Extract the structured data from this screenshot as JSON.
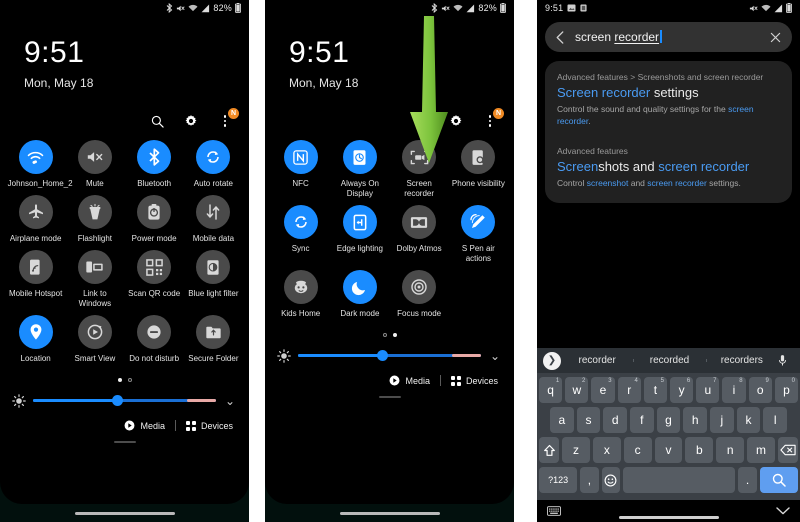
{
  "panel1": {
    "status": {
      "bluetooth": "bluetooth-icon",
      "mute": "mute-icon",
      "wifi": "wifi-icon",
      "signal": "signal-icon",
      "battery_text": "82%",
      "battery": "battery-icon"
    },
    "clock": {
      "time": "9:51",
      "date": "Mon, May 18"
    },
    "header_icons": {
      "search": "search-icon",
      "settings": "gear-icon",
      "more": "kebab-menu-icon",
      "badge": "N"
    },
    "tiles": [
      {
        "label": "Johnson_Home_2",
        "icon": "wifi",
        "on": true
      },
      {
        "label": "Mute",
        "icon": "mute",
        "on": false
      },
      {
        "label": "Bluetooth",
        "icon": "bluetooth",
        "on": true
      },
      {
        "label": "Auto rotate",
        "icon": "autorotate",
        "on": true
      },
      {
        "label": "Airplane mode",
        "icon": "airplane",
        "on": false
      },
      {
        "label": "Flashlight",
        "icon": "flashlight",
        "on": false
      },
      {
        "label": "Power mode",
        "icon": "powermode",
        "on": false
      },
      {
        "label": "Mobile data",
        "icon": "mobiledata",
        "on": false
      },
      {
        "label": "Mobile Hotspot",
        "icon": "hotspot",
        "on": false
      },
      {
        "label": "Link to Windows",
        "icon": "linkwindows",
        "on": false
      },
      {
        "label": "Scan QR code",
        "icon": "qr",
        "on": false
      },
      {
        "label": "Blue light filter",
        "icon": "bluelight",
        "on": false
      },
      {
        "label": "Location",
        "icon": "location",
        "on": true
      },
      {
        "label": "Smart View",
        "icon": "smartview",
        "on": false
      },
      {
        "label": "Do not disturb",
        "icon": "dnd",
        "on": false
      },
      {
        "label": "Secure Folder",
        "icon": "securefolder",
        "on": false
      }
    ],
    "page_dots": {
      "count": 2,
      "active_index": 0
    },
    "brightness": {
      "value_percent": 46,
      "icon": "brightness-icon",
      "expand": "chevron-down-icon"
    },
    "footer": {
      "media_label": "Media",
      "devices_label": "Devices"
    }
  },
  "panel2": {
    "status": {
      "battery_text": "82%"
    },
    "clock": {
      "time": "9:51",
      "date": "Mon, May 18"
    },
    "header_icons": {
      "search": "search-icon",
      "settings": "gear-icon",
      "more": "kebab-menu-icon",
      "badge": "N"
    },
    "annotation": {
      "type": "green-down-arrow",
      "color_light": "#9ad64a",
      "color_dark": "#5fa323"
    },
    "tiles": [
      {
        "label": "NFC",
        "icon": "nfc",
        "on": true
      },
      {
        "label": "Always On Display",
        "icon": "aod",
        "on": true
      },
      {
        "label": "Screen recorder",
        "icon": "screenrecorder",
        "on": false
      },
      {
        "label": "Phone visibility",
        "icon": "phonevisibility",
        "on": false
      },
      {
        "label": "Sync",
        "icon": "sync",
        "on": true
      },
      {
        "label": "Edge lighting",
        "icon": "edgelighting",
        "on": true
      },
      {
        "label": "Dolby Atmos",
        "icon": "dolby",
        "on": false
      },
      {
        "label": "S Pen air actions",
        "icon": "spen",
        "on": true
      },
      {
        "label": "Kids Home",
        "icon": "kids",
        "on": false
      },
      {
        "label": "Dark mode",
        "icon": "darkmode",
        "on": true
      },
      {
        "label": "Focus mode",
        "icon": "focusmode",
        "on": false
      },
      {
        "label": "",
        "icon": "none",
        "on": false
      }
    ],
    "page_dots": {
      "count": 2,
      "active_index": 1
    },
    "brightness": {
      "value_percent": 46
    },
    "footer": {
      "media_label": "Media",
      "devices_label": "Devices"
    }
  },
  "panel3": {
    "status": {
      "time": "9:51",
      "left_icons": [
        "screenshot-icon",
        "app-icon"
      ],
      "right_icons": [
        "mute-icon",
        "wifi-icon",
        "signal-icon",
        "battery-icon"
      ]
    },
    "search": {
      "back": "back-arrow-icon",
      "query_plain": "screen ",
      "query_composing": "recorder",
      "clear": "close-icon"
    },
    "results": [
      {
        "breadcrumb": "Advanced features > Screenshots and screen recorder",
        "title_parts": [
          {
            "t": "Screen recorder",
            "hl": true
          },
          {
            "t": " settings",
            "hl": false
          }
        ],
        "desc_parts": [
          {
            "t": "Control the sound and quality settings for the ",
            "hl": false
          },
          {
            "t": "screen recorder",
            "hl": true
          },
          {
            "t": ".",
            "hl": false
          }
        ]
      },
      {
        "breadcrumb": "Advanced features",
        "title_parts": [
          {
            "t": "Screen",
            "hl": true
          },
          {
            "t": "shots and ",
            "hl": false
          },
          {
            "t": "screen recorder",
            "hl": true
          }
        ],
        "desc_parts": [
          {
            "t": "Control ",
            "hl": false
          },
          {
            "t": "screenshot",
            "hl": true
          },
          {
            "t": " and ",
            "hl": false
          },
          {
            "t": "screen recorder",
            "hl": true
          },
          {
            "t": " settings.",
            "hl": false
          }
        ]
      }
    ],
    "keyboard": {
      "suggestions": [
        "recorder",
        "recorded",
        "recorders"
      ],
      "expand_icon": "chevron-right-icon",
      "mic_icon": "microphone-icon",
      "row1": [
        {
          "k": "q",
          "n": "1"
        },
        {
          "k": "w",
          "n": "2"
        },
        {
          "k": "e",
          "n": "3"
        },
        {
          "k": "r",
          "n": "4"
        },
        {
          "k": "t",
          "n": "5"
        },
        {
          "k": "y",
          "n": "6"
        },
        {
          "k": "u",
          "n": "7"
        },
        {
          "k": "i",
          "n": "8"
        },
        {
          "k": "o",
          "n": "9"
        },
        {
          "k": "p",
          "n": "0"
        }
      ],
      "row2": [
        "a",
        "s",
        "d",
        "f",
        "g",
        "h",
        "j",
        "k",
        "l"
      ],
      "row3": {
        "shift": "shift-icon",
        "keys": [
          "z",
          "x",
          "c",
          "v",
          "b",
          "n",
          "m"
        ],
        "backspace": "backspace-icon"
      },
      "row4": {
        "symbols": "?123",
        "comma": ",",
        "emoji": "emoji-icon",
        "space": "",
        "period": ".",
        "search": "search-icon"
      },
      "bottom": {
        "keyboard_icon": "keyboard-icon",
        "hide_icon": "chevron-down-icon"
      }
    }
  },
  "colors": {
    "accent_blue": "#1a8cff",
    "tile_off": "#4a4a4a",
    "link_blue": "#4a9bf2",
    "badge_orange": "#f08a24",
    "arrow_green": "#7ec242",
    "key_bg": "#565c63",
    "kb_bg": "#3b4046"
  }
}
